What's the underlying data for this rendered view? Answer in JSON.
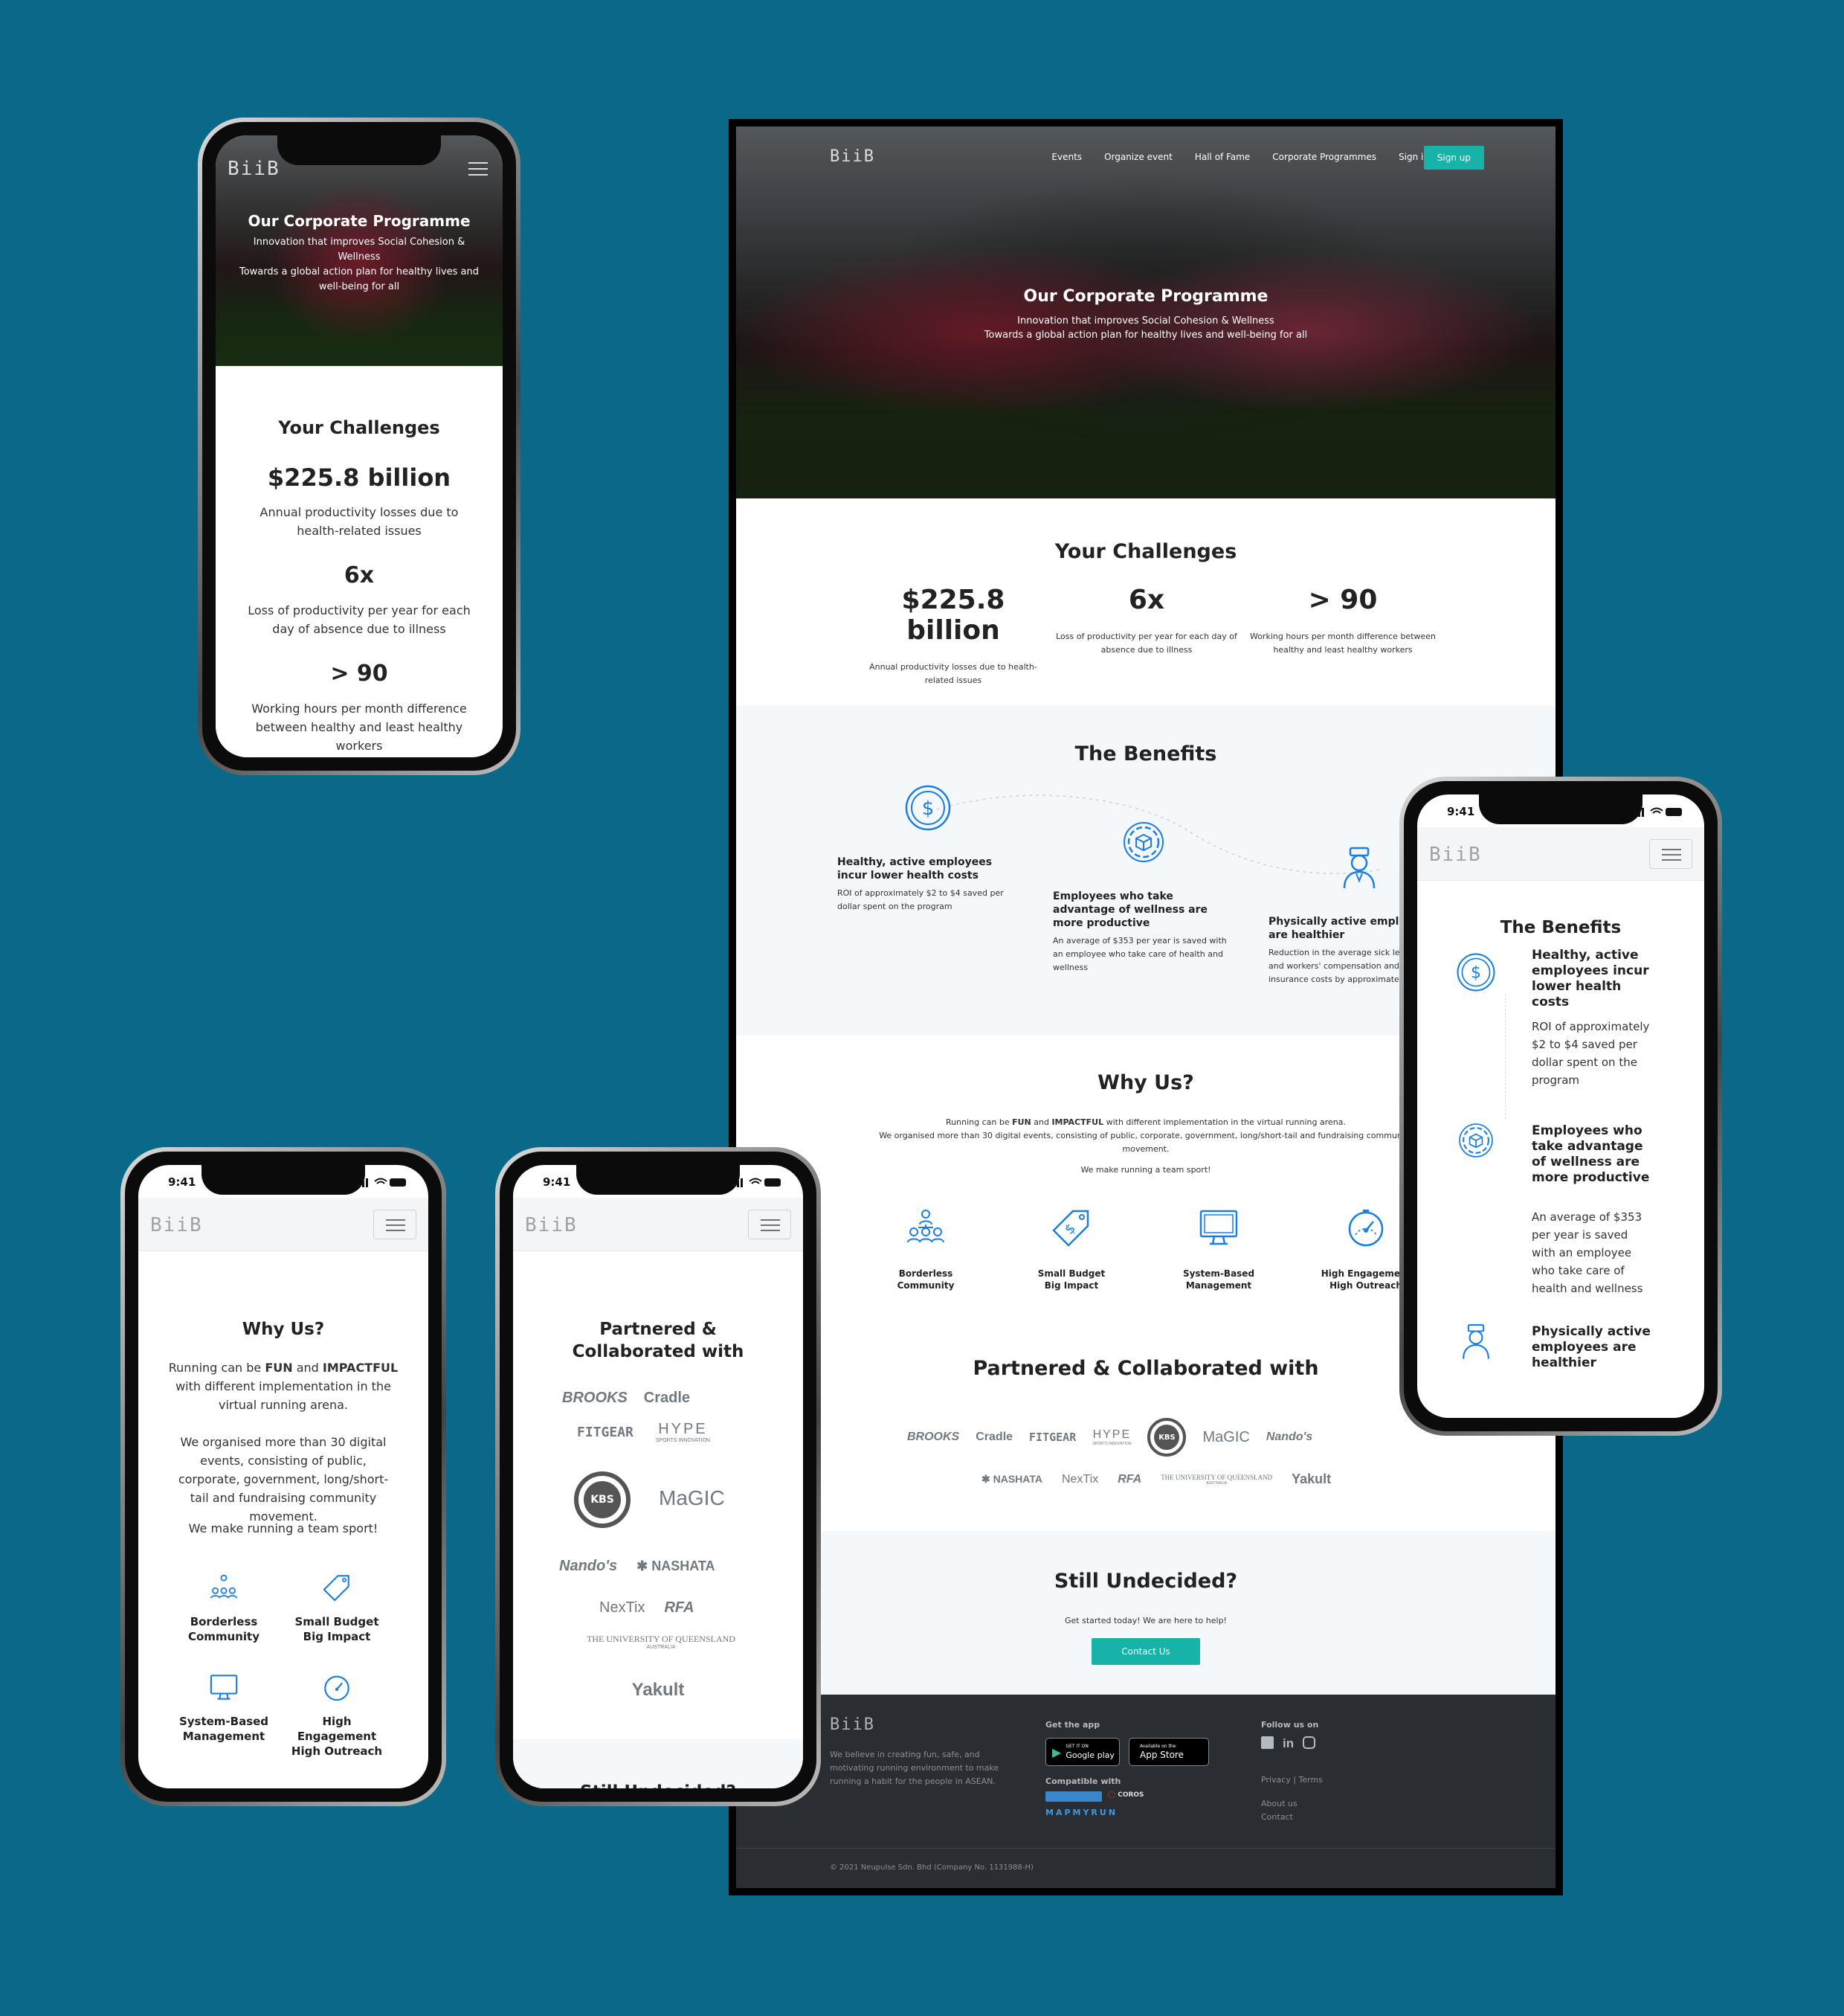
{
  "brand": {
    "logo": "BiiB",
    "accent": "#17b3a8",
    "icon_color": "#1b7ee0",
    "background": "#0a6888"
  },
  "nav": {
    "items": [
      "Events",
      "Organize event",
      "Hall of Fame",
      "Corporate Programmes",
      "Sign in"
    ],
    "signup": "Sign up"
  },
  "hero": {
    "title": "Our Corporate Programme",
    "subtitle_1": "Innovation that improves Social Cohesion & Wellness",
    "subtitle_2": "Towards a global action plan for healthy lives and well-being for all"
  },
  "challenges": {
    "title": "Your Challenges",
    "stats": [
      {
        "value": "$225.8 billion",
        "label": "Annual productivity losses due to health-related issues"
      },
      {
        "value": "6x",
        "label": "Loss of productivity per year for each day of absence due to illness"
      },
      {
        "value": "> 90",
        "label": "Working hours per month difference between healthy and least healthy workers"
      }
    ]
  },
  "benefits": {
    "title": "The Benefits",
    "items": [
      {
        "icon": "dollar-circle-icon",
        "title": "Healthy, active employees incur lower health costs",
        "desc": "ROI of approximately $2 to $4 saved per dollar spent on the program"
      },
      {
        "icon": "gear-cube-icon",
        "title": "Employees who take advantage of wellness are more productive",
        "desc": "An average of $353 per year is saved with an employee who take care of health and wellness"
      },
      {
        "icon": "doctor-icon",
        "title": "Physically active employees are healthier",
        "desc": "Reduction in the average sick leave plan, and workers' compensation and disability insurance costs by approximately 25 percent"
      }
    ]
  },
  "why": {
    "title": "Why Us?",
    "line1_pre": "Running can be ",
    "fun": "FUN",
    "and": " and ",
    "impactful": "IMPACTFUL",
    "line1_post": " with different implementation in the virtual running arena.",
    "line2": "We organised more than 30 digital events, consisting of public, corporate, government, long/short-tail and fundraising community movement.",
    "line3": "We make running a team sport!",
    "features": [
      {
        "icon": "community-icon",
        "line1": "Borderless",
        "line2": "Community"
      },
      {
        "icon": "price-tag-icon",
        "line1": "Small Budget",
        "line2": "Big Impact"
      },
      {
        "icon": "monitor-icon",
        "line1": "System-Based",
        "line2": "Management"
      },
      {
        "icon": "gauge-icon",
        "line1": "High Engagement",
        "line2": "High Outreach"
      }
    ]
  },
  "partners": {
    "title": "Partnered & Collaborated with",
    "logos": [
      "BROOKS",
      "Cradle",
      "FITGEAR",
      "HYPE",
      "SPORTS INNOVATION",
      "KBS",
      "MaGIC",
      "Nando's",
      "NASHATA",
      "NexTix",
      "RFA",
      "THE UNIVERSITY OF QUEENSLAND",
      "AUSTRALIA",
      "Yakult"
    ]
  },
  "undecided": {
    "title": "Still Undecided?",
    "text": "Get started today! We are here to help!",
    "button": "Contact Us"
  },
  "footer": {
    "about": "We believe in creating fun, safe, and motivating running environment to make running a habit for the people in ASEAN.",
    "get_app": "Get the app",
    "google_small": "GET IT ON",
    "google": "Google play",
    "apple_small": "Available on the",
    "apple": "App Store",
    "compatible": "Compatible with",
    "compat_logos": [
      "COROS",
      "MAPMYRUN"
    ],
    "follow": "Follow us on",
    "privacy": "Privacy",
    "sep": "|",
    "terms": "Terms",
    "about_us": "About us",
    "contact": "Contact",
    "copyright": "© 2021 Neupulse Sdn. Bhd (Company No. 1131988-H)"
  },
  "phone_status": {
    "time": "9:41"
  }
}
